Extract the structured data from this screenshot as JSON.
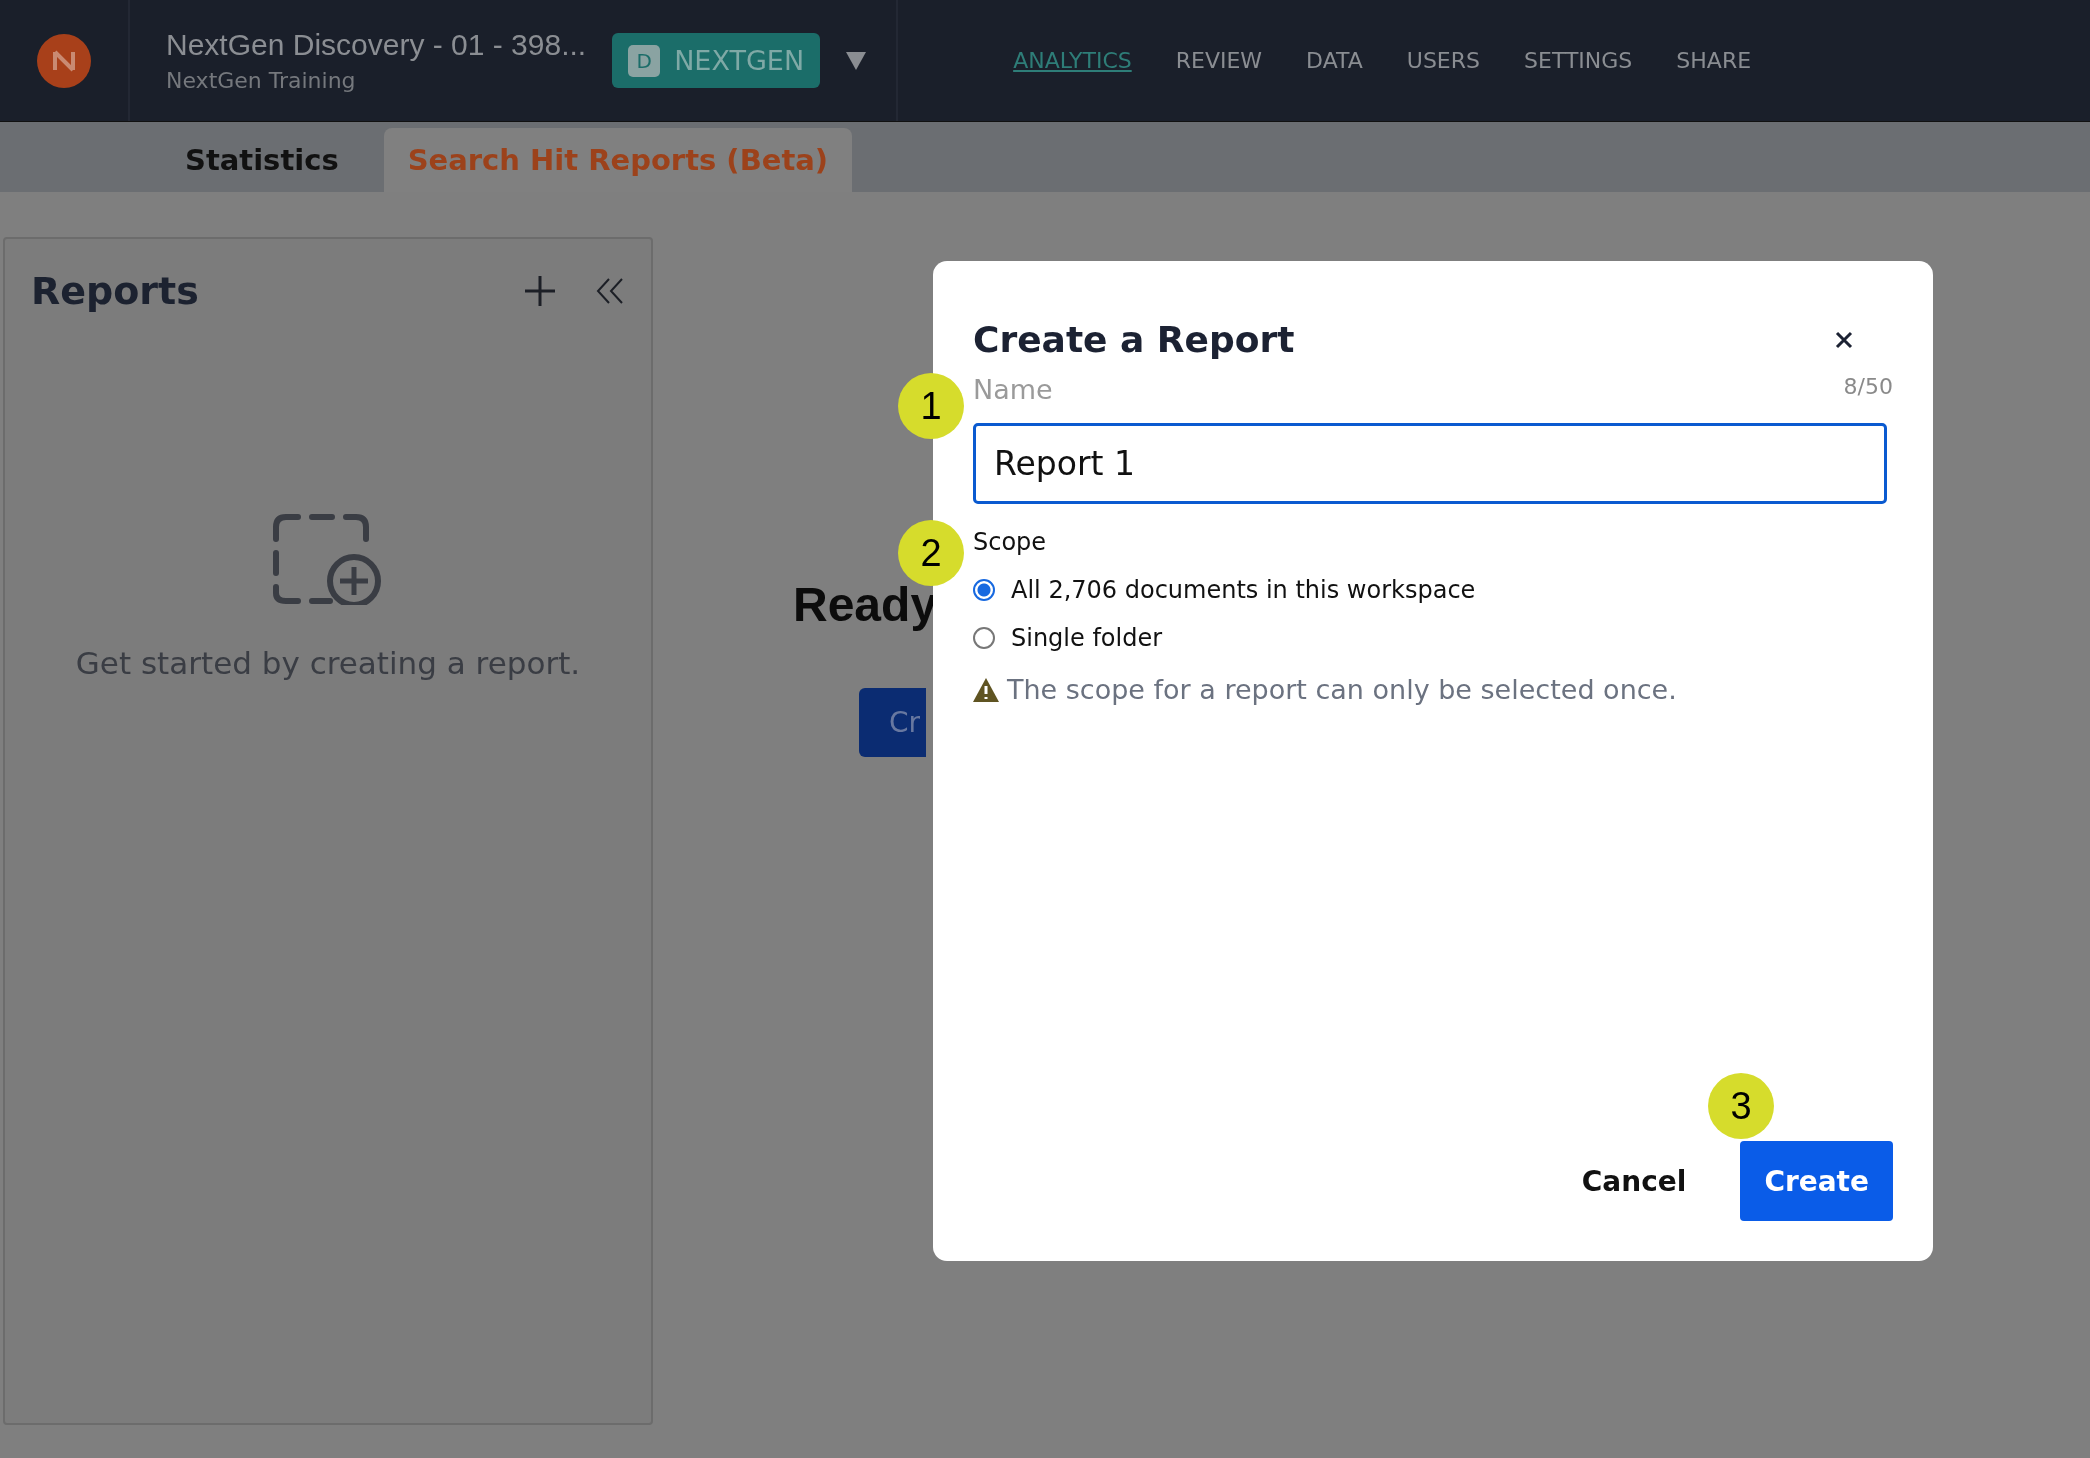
{
  "header": {
    "project_title": "NextGen Discovery - 01 - 398...",
    "project_subtitle": "NextGen Training",
    "workspace_badge": {
      "letter": "D",
      "label": "NEXTGEN"
    },
    "nav": [
      {
        "label": "ANALYTICS",
        "selected": true
      },
      {
        "label": "REVIEW",
        "selected": false
      },
      {
        "label": "DATA",
        "selected": false
      },
      {
        "label": "USERS",
        "selected": false
      },
      {
        "label": "SETTINGS",
        "selected": false
      },
      {
        "label": "SHARE",
        "selected": false
      }
    ]
  },
  "tabs": [
    {
      "label": "Statistics",
      "selected": false
    },
    {
      "label": "Search Hit Reports (Beta)",
      "selected": true
    }
  ],
  "reports_panel": {
    "title": "Reports",
    "empty_message": "Get started by creating a report."
  },
  "main": {
    "heading": "Ready",
    "button": "Cr"
  },
  "dialog": {
    "title": "Create a Report",
    "name_label": "Name",
    "counter": "8/50",
    "name_value": "Report 1",
    "scope_label": "Scope",
    "scope_options": [
      {
        "label": "All 2,706 documents in this workspace",
        "selected": true
      },
      {
        "label": "Single folder",
        "selected": false
      }
    ],
    "warning": "The scope for a report can only be selected once.",
    "cancel": "Cancel",
    "create": "Create"
  },
  "callouts": [
    "1",
    "2",
    "3"
  ]
}
